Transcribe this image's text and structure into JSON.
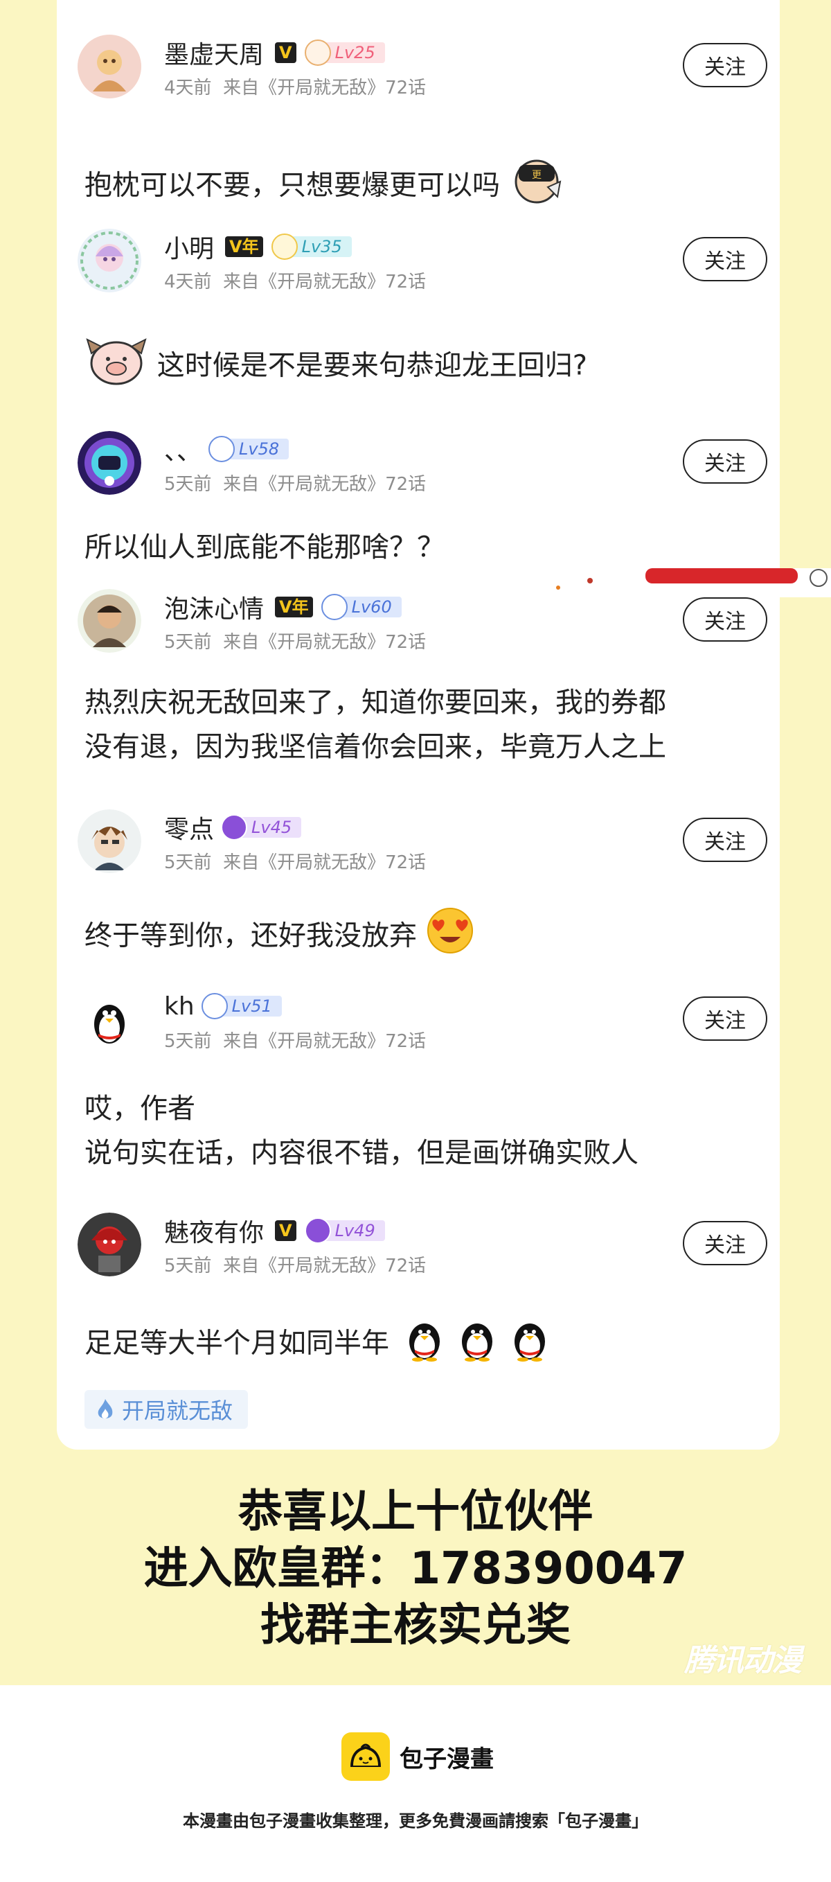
{
  "comments": [
    {
      "username": "墨虚天周",
      "vip": "V",
      "level": "Lv25",
      "time": "4天前",
      "source": "来自《开局就无敌》72话",
      "follow": "关注",
      "text": [
        "抱枕可以不要，只想要爆更可以吗"
      ]
    },
    {
      "username": "小明",
      "vip": "V年",
      "level": "Lv35",
      "time": "4天前",
      "source": "来自《开局就无敌》72话",
      "follow": "关注",
      "text": [
        "这时候是不是要来句恭迎龙王回归?"
      ]
    },
    {
      "username": "、、",
      "level": "Lv58",
      "time": "5天前",
      "source": "来自《开局就无敌》72话",
      "follow": "关注",
      "text": [
        "所以仙人到底能不能那啥？？"
      ]
    },
    {
      "username": "泡沫心情",
      "vip": "V年",
      "level": "Lv60",
      "time": "5天前",
      "source": "来自《开局就无敌》72话",
      "follow": "关注",
      "text": [
        "热烈庆祝无敌回来了，知道你要回来，我的券都",
        "没有退，因为我坚信着你会回来，毕竟万人之上"
      ]
    },
    {
      "username": "零点",
      "level": "Lv45",
      "time": "5天前",
      "source": "来自《开局就无敌》72话",
      "follow": "关注",
      "text": [
        "终于等到你，还好我没放弃"
      ]
    },
    {
      "username": "kh",
      "level": "Lv51",
      "time": "5天前",
      "source": "来自《开局就无敌》72话",
      "follow": "关注",
      "text": [
        "哎，作者",
        "说句实在话，内容很不错，但是画饼确实败人"
      ]
    },
    {
      "username": "魅夜有你",
      "vip": "V",
      "level": "Lv49",
      "time": "5天前",
      "source": "来自《开局就无敌》72话",
      "follow": "关注",
      "text": [
        "足足等大半个月如同半年"
      ]
    }
  ],
  "tag": "开局就无敌",
  "banner": [
    "恭喜以上十位伙伴",
    "进入欧皇群：178390047",
    "找群主核实兑奖"
  ],
  "watermark": "腾讯动漫",
  "footer": {
    "logo_text": "包子漫畫",
    "note": "本漫畫由包子漫畫收集整理，更多免費漫画請搜索「包子漫畫」"
  }
}
